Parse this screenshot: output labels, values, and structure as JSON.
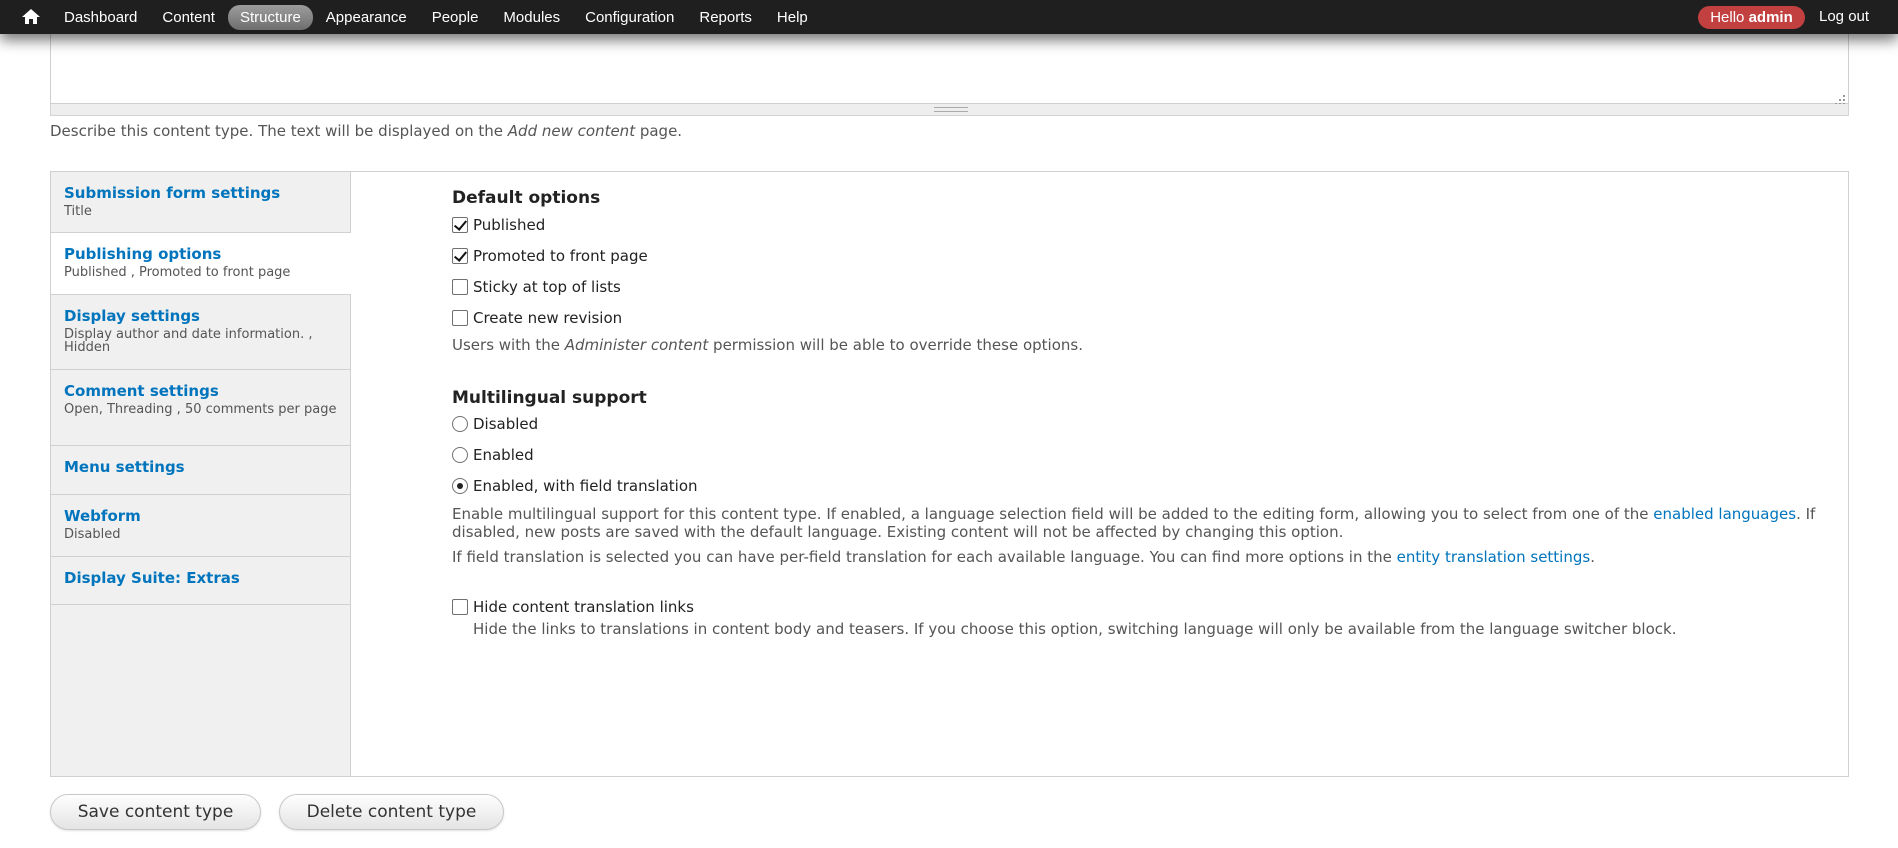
{
  "toolbar": {
    "home_icon": "home-icon",
    "menu": [
      "Dashboard",
      "Content",
      "Structure",
      "Appearance",
      "People",
      "Modules",
      "Configuration",
      "Reports",
      "Help"
    ],
    "active_item": "Structure",
    "hello_prefix": "Hello",
    "user": "admin",
    "logout": "Log out",
    "colors": {
      "bar": "#1f1f1f",
      "hello_badge": "#c24040",
      "active_pill": "#8a8a8a"
    }
  },
  "description": {
    "textarea_value": "",
    "help_prefix": "Describe this content type. The text will be displayed on the ",
    "help_em": "Add new content",
    "help_suffix": " page."
  },
  "vertical_tabs": [
    {
      "id": "submission",
      "title": "Submission form settings",
      "summary": "Title"
    },
    {
      "id": "publishing",
      "title": "Publishing options",
      "summary": "Published , Promoted to front page",
      "selected": true
    },
    {
      "id": "display",
      "title": "Display settings",
      "summary": "Display author and date information. , Hidden"
    },
    {
      "id": "comment",
      "title": "Comment settings",
      "summary": "Open, Threading , 50 comments per page"
    },
    {
      "id": "menu",
      "title": "Menu settings",
      "summary": ""
    },
    {
      "id": "webform",
      "title": "Webform",
      "summary": "Disabled"
    },
    {
      "id": "dsextras",
      "title": "Display Suite: Extras",
      "summary": ""
    }
  ],
  "default_options": {
    "heading": "Default options",
    "options": [
      {
        "label": "Published",
        "checked": true
      },
      {
        "label": "Promoted to front page",
        "checked": true
      },
      {
        "label": "Sticky at top of lists",
        "checked": false
      },
      {
        "label": "Create new revision",
        "checked": false
      }
    ],
    "help_prefix": "Users with the ",
    "help_em": "Administer content",
    "help_suffix": " permission will be able to override these options."
  },
  "multilingual": {
    "heading": "Multilingual support",
    "options": [
      {
        "label": "Disabled",
        "selected": false
      },
      {
        "label": "Enabled",
        "selected": false
      },
      {
        "label": "Enabled, with field translation",
        "selected": true
      }
    ],
    "help1_prefix": "Enable multilingual support for this content type. If enabled, a language selection field will be added to the editing form, allowing you to select from one of the ",
    "help1_link": "enabled languages",
    "help1_suffix": ". If disabled, new posts are saved with the default language. Existing content will not be affected by changing this option.",
    "help2_prefix": "If field translation is selected you can have per-field translation for each available language. You can find more options in the ",
    "help2_link": "entity translation settings",
    "help2_suffix": "."
  },
  "hide_links": {
    "label": "Hide content translation links",
    "checked": false,
    "help": "Hide the links to translations in content body and teasers. If you choose this option, switching language will only be available from the language switcher block."
  },
  "actions": {
    "save": "Save content type",
    "delete": "Delete content type"
  }
}
